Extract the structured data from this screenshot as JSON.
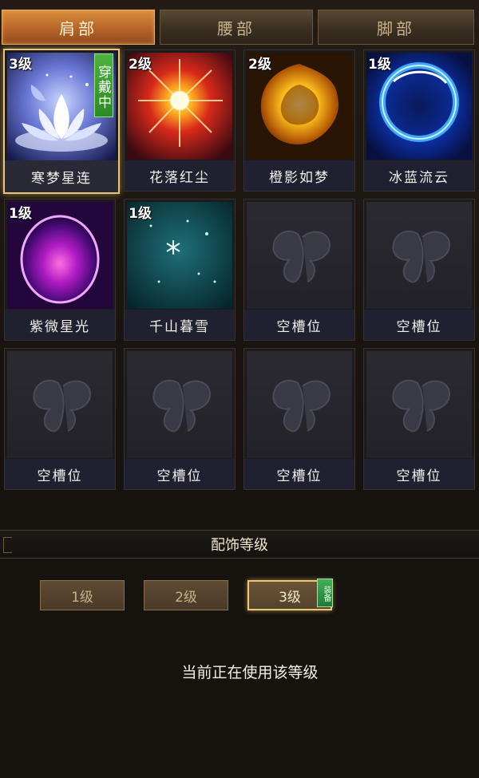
{
  "tabs": [
    {
      "label": "肩部",
      "active": true
    },
    {
      "label": "腰部",
      "active": false
    },
    {
      "label": "脚部",
      "active": false
    }
  ],
  "items": [
    {
      "level": "3级",
      "name": "寒梦星连",
      "selected": true,
      "wearing_badge": "穿戴中",
      "art": "lotus"
    },
    {
      "level": "2级",
      "name": "花落红尘",
      "selected": false,
      "art": "starburst"
    },
    {
      "level": "2级",
      "name": "橙影如梦",
      "selected": false,
      "art": "flame"
    },
    {
      "level": "1级",
      "name": "冰蓝流云",
      "selected": false,
      "art": "blue-ring"
    },
    {
      "level": "1级",
      "name": "紫微星光",
      "selected": false,
      "art": "purple-orb"
    },
    {
      "level": "1级",
      "name": "千山暮雪",
      "selected": false,
      "art": "snowflake"
    },
    {
      "name": "空槽位",
      "empty": true
    },
    {
      "name": "空槽位",
      "empty": true
    },
    {
      "name": "空槽位",
      "empty": true
    },
    {
      "name": "空槽位",
      "empty": true
    },
    {
      "name": "空槽位",
      "empty": true
    },
    {
      "name": "空槽位",
      "empty": true
    }
  ],
  "section": {
    "title": "配饰等级"
  },
  "level_buttons": [
    {
      "label": "1级",
      "active": false
    },
    {
      "label": "2级",
      "active": false
    },
    {
      "label": "3级",
      "active": true
    }
  ],
  "equip_badge": "装备",
  "status_text": "当前正在使用该等级"
}
